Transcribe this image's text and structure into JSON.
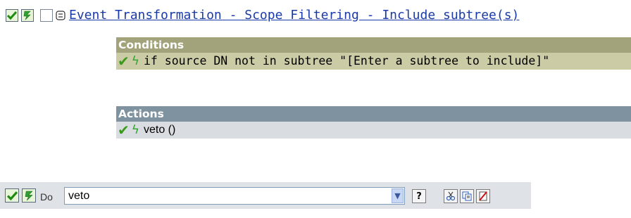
{
  "rule": {
    "title": "Event Transformation - Scope Filtering - Include subtree(s)"
  },
  "conditions": {
    "header": "Conditions",
    "items": [
      {
        "text": "if source DN not in subtree \"[Enter a subtree to include]\""
      }
    ]
  },
  "actions": {
    "header": "Actions",
    "items": [
      {
        "text": "veto ()"
      }
    ]
  },
  "do_bar": {
    "label": "Do",
    "selected_action": "veto",
    "help_label": "?"
  },
  "colors": {
    "conditions_bg": "#a3a37b",
    "conditions_row_bg": "#cbcba6",
    "actions_bg": "#7f929f",
    "actions_row_bg": "#d9dde1",
    "link": "#1a3aa8",
    "check": "#3a9a1a"
  },
  "icons": {
    "enabled": "checkmark-icon",
    "trace": "lightning-icon",
    "select": "checkbox-icon",
    "collapse": "collapse-icon",
    "help": "help-icon",
    "cut": "cut-icon",
    "copy": "copy-icon",
    "delete": "delete-icon"
  }
}
